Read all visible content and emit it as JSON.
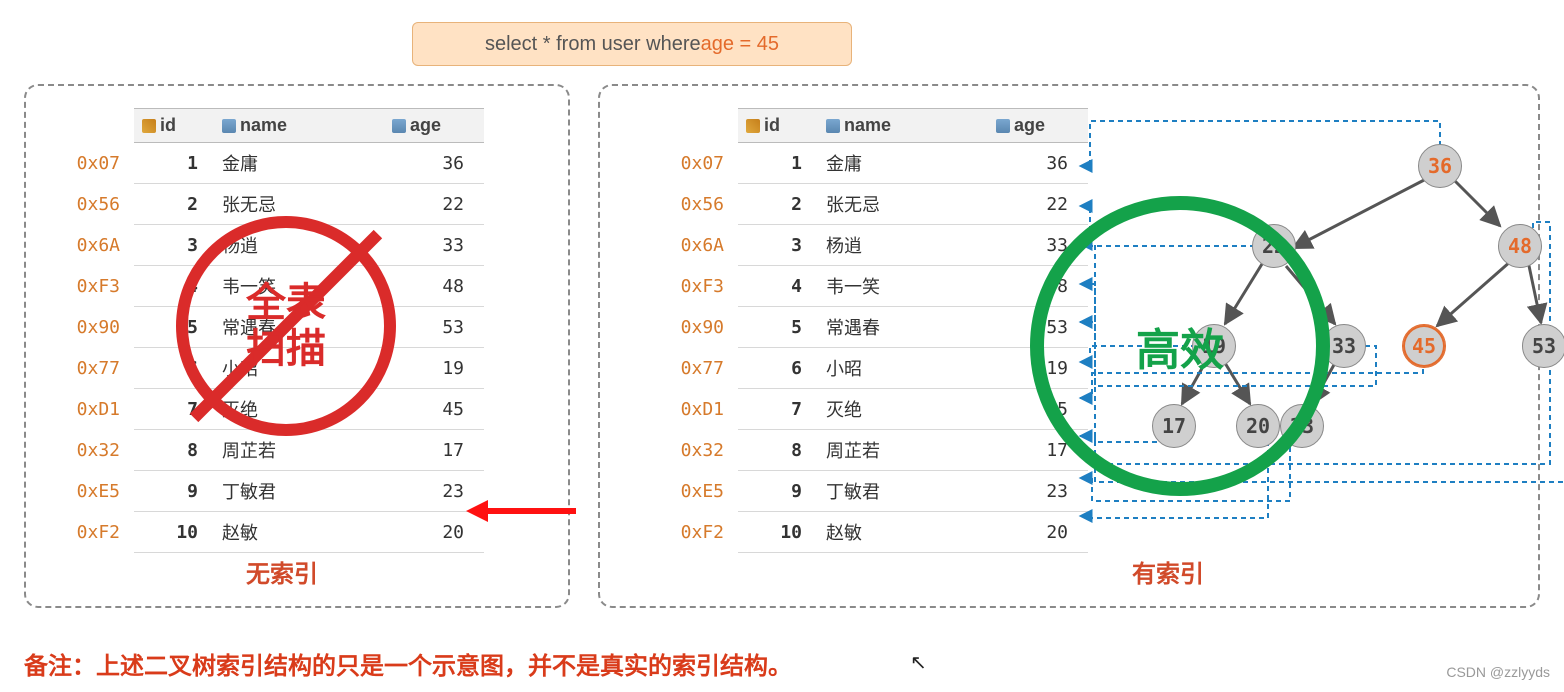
{
  "sql": {
    "prefix": "select * from user where ",
    "accent": "age = 45"
  },
  "columns": {
    "id": "id",
    "name": "name",
    "age": "age"
  },
  "rows": [
    {
      "addr": "0x07",
      "id": "1",
      "name": "金庸",
      "age": "36"
    },
    {
      "addr": "0x56",
      "id": "2",
      "name": "张无忌",
      "age": "22"
    },
    {
      "addr": "0x6A",
      "id": "3",
      "name": "杨逍",
      "age": "33"
    },
    {
      "addr": "0xF3",
      "id": "4",
      "name": "韦一笑",
      "age": "48"
    },
    {
      "addr": "0x90",
      "id": "5",
      "name": "常遇春",
      "age": "53"
    },
    {
      "addr": "0x77",
      "id": "6",
      "name": "小昭",
      "age": "19"
    },
    {
      "addr": "0xD1",
      "id": "7",
      "name": "灭绝",
      "age": "45"
    },
    {
      "addr": "0x32",
      "id": "8",
      "name": "周芷若",
      "age": "17"
    },
    {
      "addr": "0xE5",
      "id": "9",
      "name": "丁敏君",
      "age": "23"
    },
    {
      "addr": "0xF2",
      "id": "10",
      "name": "赵敏",
      "age": "20"
    }
  ],
  "left": {
    "caption": "无索引",
    "ban_l1": "全表",
    "ban_l2": "扫描"
  },
  "right": {
    "caption": "有索引",
    "eff_text": "高效"
  },
  "tree_nodes": {
    "n36": "36",
    "n22": "22",
    "n48": "48",
    "n19": "19",
    "n33": "33",
    "n45": "45",
    "n53": "53",
    "n17": "17",
    "n20": "20",
    "n23": "23"
  },
  "note": "备注：上述二叉树索引结构的只是一个示意图，并不是真实的索引结构。",
  "watermark": "CSDN @zzlyyds"
}
